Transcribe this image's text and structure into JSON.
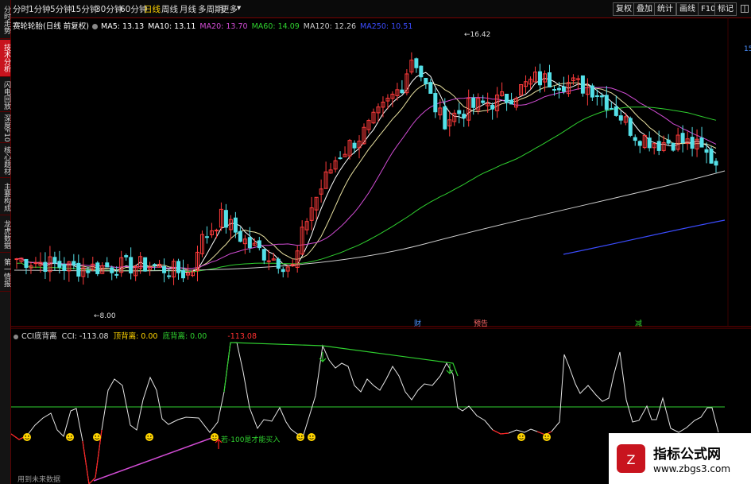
{
  "sidebar": {
    "tabs": [
      {
        "label": "分时走势",
        "active": false
      },
      {
        "label": "技术分析",
        "active": true
      },
      {
        "label": "闪电回放",
        "active": false
      },
      {
        "label": "深度F10",
        "active": false
      },
      {
        "label": "核心题材",
        "active": false
      },
      {
        "label": "主要构成",
        "active": false
      },
      {
        "label": "龙虎数据",
        "active": false
      },
      {
        "label": "第一情报",
        "active": false
      }
    ]
  },
  "toolbar": {
    "periods": [
      "分时",
      "1分钟",
      "5分钟",
      "15分钟",
      "30分钟",
      "60分钟",
      "日线",
      "周线",
      "月线",
      "多周期",
      "更多"
    ],
    "active_period": "日线",
    "more_arrow": "▾",
    "right_buttons": [
      "复权",
      "叠加",
      "统计",
      "画线",
      "F10",
      "标记"
    ],
    "extra_icon": "layout-icon"
  },
  "main_legend": {
    "title": "赛轮轮胎(日线 前复权)",
    "items": [
      {
        "text": "MA5: 13.13",
        "color": "#ffffff"
      },
      {
        "text": "MA10: 13.11",
        "color": "#ffffff"
      },
      {
        "text": "MA20: 13.70",
        "color": "#d14cd4"
      },
      {
        "text": "MA60: 14.09",
        "color": "#2fd02f"
      },
      {
        "text": "MA120: 12.26",
        "color": "#cccccc"
      },
      {
        "text": "MA250: 10.51",
        "color": "#3b4cff"
      }
    ],
    "high_label": "16.42",
    "low_label": "8.00",
    "right_edge_label": "15",
    "markers": [
      "财",
      "预告",
      "减"
    ],
    "marker_colors": [
      "#4a90ff",
      "#ff6a6a",
      "#2fd02f"
    ]
  },
  "indicator_legend": {
    "items": [
      {
        "text": "CCI底背离",
        "color": "#dddddd"
      },
      {
        "text": "CCI: -113.08",
        "color": "#dddddd"
      },
      {
        "text": "顶背离: 0.00",
        "color": "#ffd400"
      },
      {
        "text": "底背离: 0.00",
        "color": "#2fd02f"
      },
      {
        "text": "-113.08",
        "color": "#ff3030"
      }
    ],
    "annotation": "若-100是才能买入"
  },
  "footer": {
    "future_label": "用到未来数据"
  },
  "watermark": {
    "cn": "指标公式网",
    "url": "www.zbgs3.com"
  },
  "chart_data": {
    "type": "candlestick",
    "price_range": [
      7.5,
      17.0
    ],
    "labels": {
      "high": 16.42,
      "low": 8.0
    },
    "cci_threshold": 100
  }
}
